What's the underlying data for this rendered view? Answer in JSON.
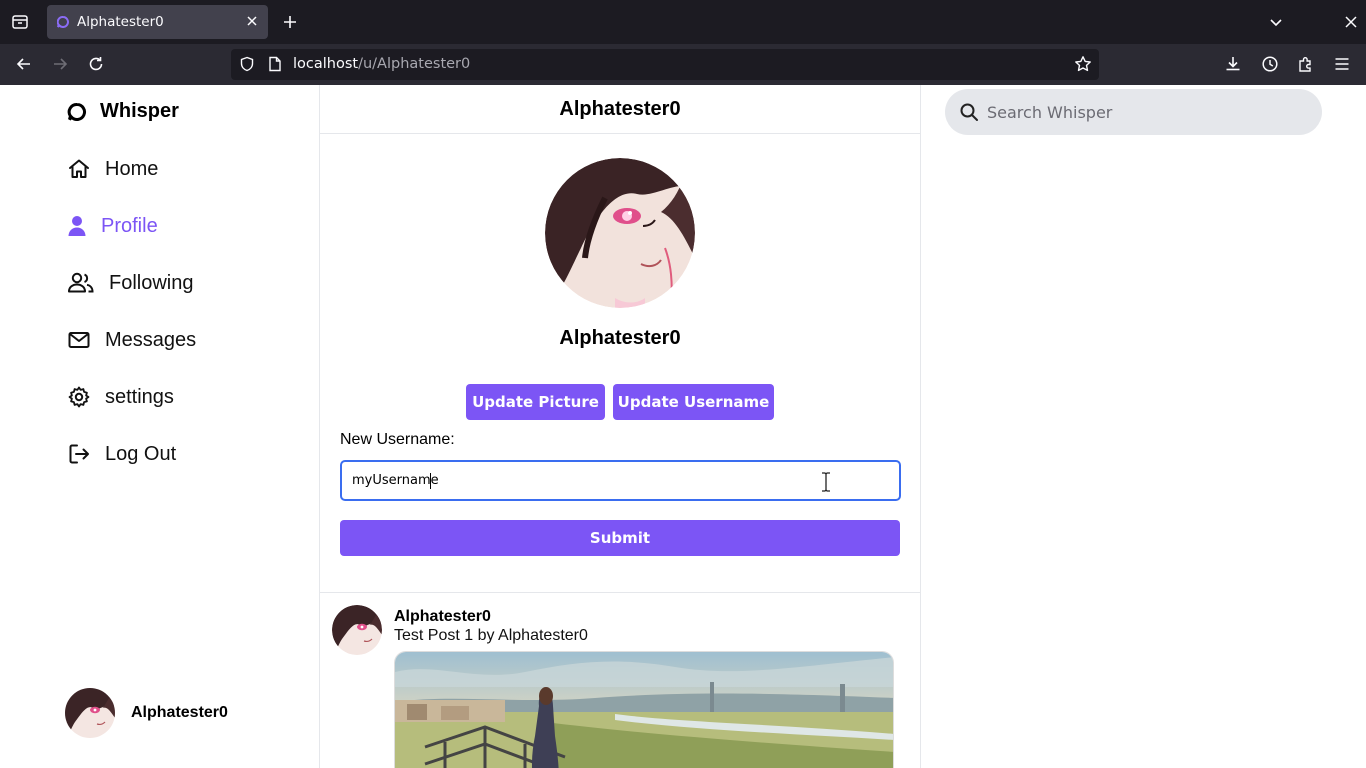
{
  "browser": {
    "tab_title": "Alphatester0",
    "url_host": "localhost",
    "url_path": "/u/Alphatester0"
  },
  "app": {
    "brand": "Whisper",
    "accent_color": "#7c55f5"
  },
  "sidebar": {
    "items": [
      {
        "label": "Home",
        "icon": "home-icon"
      },
      {
        "label": "Profile",
        "icon": "user-icon",
        "active": true
      },
      {
        "label": "Following",
        "icon": "users-icon"
      },
      {
        "label": "Messages",
        "icon": "mail-icon"
      },
      {
        "label": "settings",
        "icon": "gear-icon"
      },
      {
        "label": "Log Out",
        "icon": "logout-icon"
      }
    ],
    "user": {
      "name": "Alphatester0"
    }
  },
  "main": {
    "header_title": "Alphatester0",
    "profile_name": "Alphatester0",
    "update_picture_label": "Update Picture",
    "update_username_label": "Update Username",
    "new_username_label": "New Username:",
    "new_username_value": "myUsername",
    "submit_label": "Submit"
  },
  "posts": [
    {
      "author": "Alphatester0",
      "body": "Test Post 1 by Alphatester0"
    }
  ],
  "search": {
    "placeholder": "Search Whisper"
  }
}
